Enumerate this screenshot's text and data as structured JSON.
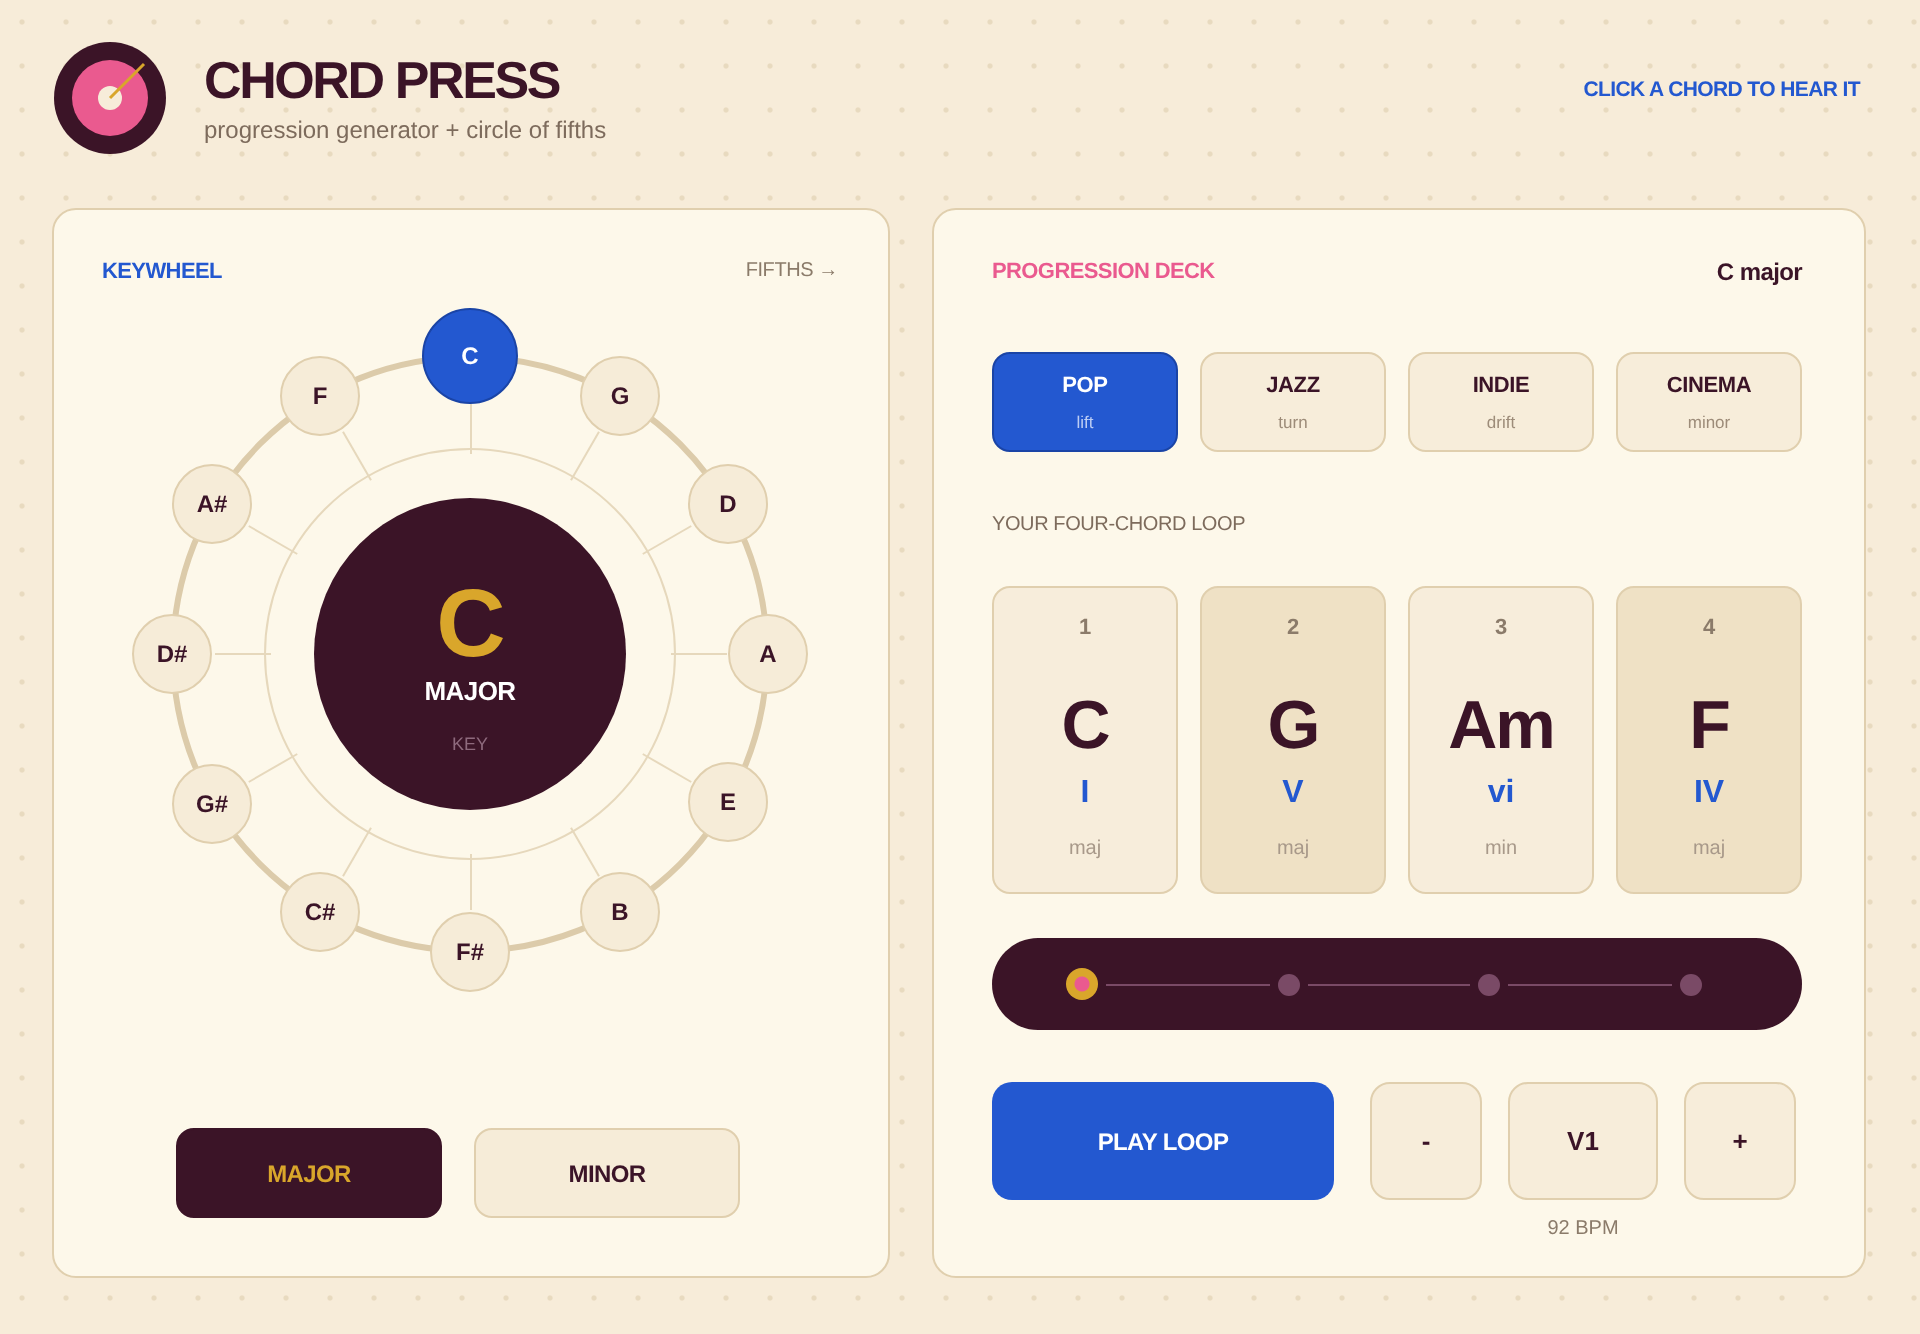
{
  "header": {
    "title": "CHORD PRESS",
    "subtitle": "progression generator + circle of fifths",
    "hint": "CLICK A CHORD TO HEAR IT"
  },
  "keywheel": {
    "title": "KEYWHEEL",
    "direction_label": "FIFTHS →",
    "keys": [
      {
        "label": "C",
        "selected": true
      },
      {
        "label": "G",
        "selected": false
      },
      {
        "label": "D",
        "selected": false
      },
      {
        "label": "A",
        "selected": false
      },
      {
        "label": "E",
        "selected": false
      },
      {
        "label": "B",
        "selected": false
      },
      {
        "label": "F#",
        "selected": false
      },
      {
        "label": "C#",
        "selected": false
      },
      {
        "label": "G#",
        "selected": false
      },
      {
        "label": "D#",
        "selected": false
      },
      {
        "label": "A#",
        "selected": false
      },
      {
        "label": "F",
        "selected": false
      }
    ],
    "center": {
      "key": "C",
      "mode": "MAJOR",
      "caption": "KEY"
    },
    "modes": [
      {
        "label": "MAJOR",
        "selected": true
      },
      {
        "label": "MINOR",
        "selected": false
      }
    ]
  },
  "deck": {
    "title": "PROGRESSION DECK",
    "key_label": "C major",
    "styles": [
      {
        "label": "POP",
        "sub": "lift",
        "selected": true
      },
      {
        "label": "JAZZ",
        "sub": "turn",
        "selected": false
      },
      {
        "label": "INDIE",
        "sub": "drift",
        "selected": false
      },
      {
        "label": "CINEMA",
        "sub": "minor",
        "selected": false
      }
    ],
    "loop_label": "YOUR FOUR-CHORD LOOP",
    "chords": [
      {
        "step": "1",
        "name": "C",
        "numeral": "I",
        "quality": "maj"
      },
      {
        "step": "2",
        "name": "G",
        "numeral": "V",
        "quality": "maj"
      },
      {
        "step": "3",
        "name": "Am",
        "numeral": "vi",
        "quality": "min"
      },
      {
        "step": "4",
        "name": "F",
        "numeral": "IV",
        "quality": "maj"
      }
    ],
    "loop_steps": [
      {
        "selected": true
      },
      {
        "selected": false
      },
      {
        "selected": false
      },
      {
        "selected": false
      }
    ],
    "play_button": "PLAY LOOP",
    "tempo": {
      "decrease": "-",
      "value": "V1",
      "increase": "+",
      "reading": "92 BPM"
    }
  }
}
